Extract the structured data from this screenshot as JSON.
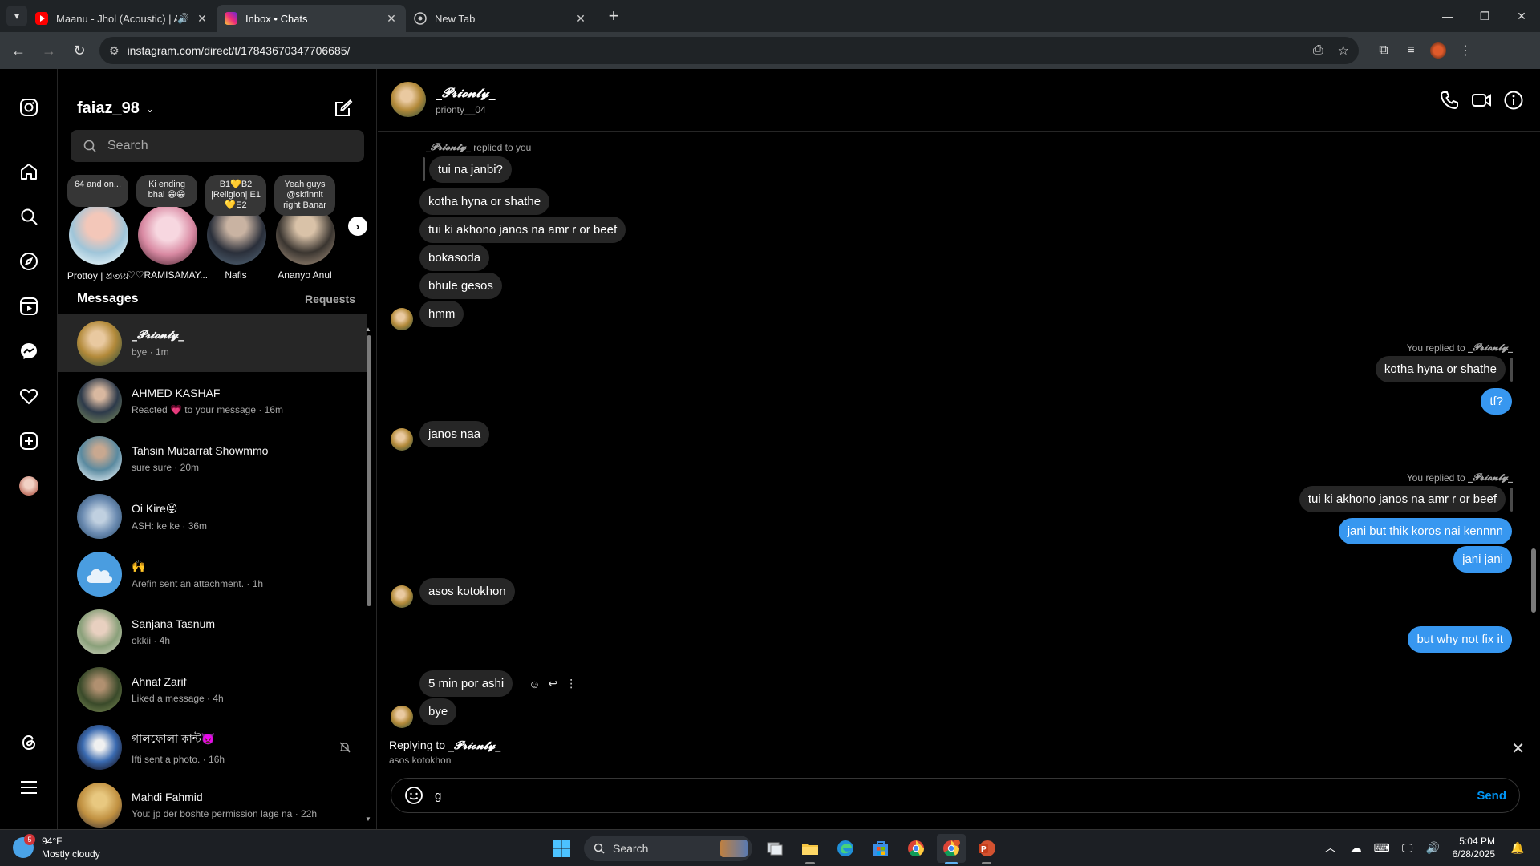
{
  "browser": {
    "tabs": [
      {
        "title": "Maanu - Jhol (Acoustic) | Ar",
        "favicon": "youtube-icon",
        "audio": true
      },
      {
        "title": "Inbox • Chats",
        "favicon": "instagram-icon",
        "active": true
      },
      {
        "title": "New Tab",
        "favicon": "chrome-icon"
      }
    ],
    "url": "instagram.com/direct/t/17843670347706685/"
  },
  "inbox": {
    "username": "faiaz_98",
    "search_placeholder": "Search",
    "stories": [
      {
        "note": "64 and on...",
        "name": "Prottoy | প্রত্যয়"
      },
      {
        "note": "Ki ending bhai 😁😁",
        "name": "♡♡RAMISAMAY..."
      },
      {
        "note": "B1💛B2 |Religion| E1💛E2",
        "name": "Nafis"
      },
      {
        "note": "Yeah guys @skfinnit right Banar",
        "name": "Ananyo Anul"
      }
    ],
    "messages_label": "Messages",
    "requests_label": "Requests",
    "threads": [
      {
        "name": "_𝓟𝓻𝓲𝓸𝓷𝓽𝔂_",
        "preview": "bye · 1m",
        "active": true
      },
      {
        "name": "AHMED KASHAF",
        "preview": "Reacted 💗 to your message · 16m"
      },
      {
        "name": "Tahsin Mubarrat Showmmo",
        "preview": "sure sure · 20m"
      },
      {
        "name": "Oi Kire😝",
        "preview": "ASH: ke ke · 36m"
      },
      {
        "name": "🙌",
        "preview": "Arefin sent an attachment. · 1h"
      },
      {
        "name": "Sanjana Tasnum",
        "preview": "okkii · 4h"
      },
      {
        "name": "Ahnaf Zarif",
        "preview": "Liked a message · 4h"
      },
      {
        "name": "গালফোলা কান্ট👿",
        "preview": "Ifti sent a photo. · 16h",
        "muted": true
      },
      {
        "name": "Mahdi Fahmid",
        "preview": "You: jp der boshte permission lage na · 22h"
      }
    ]
  },
  "chat": {
    "name": "_𝓟𝓻𝓲𝓸𝓷𝓽𝔂_",
    "username": "prionty__04",
    "messages": {
      "ctx1": "replied to you",
      "ctx1_name": "_𝓟𝓻𝓲𝓸𝓷𝓽𝔂_",
      "m1": "tui na janbi?",
      "m2": "kotha hyna   or shathe",
      "m3": "tui ki akhono janos na amr r or beef",
      "m4": "bokasoda",
      "m5": "bhule gesos",
      "m6": "hmm",
      "ctx2": "You replied to",
      "ctx2_name": "_𝓟𝓻𝓲𝓸𝓷𝓽𝔂_",
      "m7": "kotha hyna or shathe",
      "m8": "tf?",
      "m9": "janos naa",
      "ctx3": "You replied to",
      "ctx3_name": "_𝓟𝓻𝓲𝓸𝓷𝓽𝔂_",
      "m10": "tui ki akhono janos na amr r or beef",
      "m11": "jani but thik koros nai kennnn",
      "m12": "jani jani",
      "m13": "asos kotokhon",
      "m14": "but why not fix it",
      "m15": "5 min por ashi",
      "m16": "bye"
    },
    "replying_label": "Replying to",
    "replying_name": "_𝓟𝓻𝓲𝓸𝓷𝓽𝔂_",
    "replying_snippet": "asos kotokhon",
    "input_value": "g",
    "send_label": "Send"
  },
  "taskbar": {
    "temp": "94°F",
    "weather": "Mostly cloudy",
    "weather_badge": "5",
    "search_label": "Search",
    "time": "5:04 PM",
    "date": "6/28/2025"
  },
  "colors": {
    "accent": "#3797f0",
    "link": "#0095f6",
    "bubble_in": "#262626"
  }
}
